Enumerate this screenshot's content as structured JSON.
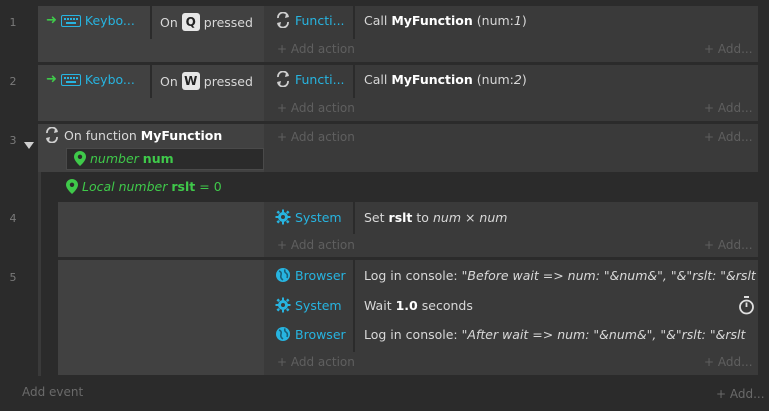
{
  "events": [
    {
      "number": "1",
      "condition": {
        "object": "Keybo...",
        "prefix": "On",
        "key": "Q",
        "suffix": "pressed"
      },
      "action": {
        "object": "Functi...",
        "text_prefix": "Call",
        "func": "MyFunction",
        "args": "(num: ",
        "argval": "1",
        "argclose": ")"
      }
    },
    {
      "number": "2",
      "condition": {
        "object": "Keybo...",
        "prefix": "On",
        "key": "W",
        "suffix": "pressed"
      },
      "action": {
        "object": "Functi...",
        "text_prefix": "Call",
        "func": "MyFunction",
        "args": "(num: ",
        "argval": "2",
        "argclose": ")"
      }
    }
  ],
  "function_block": {
    "number": "3",
    "label": "On function",
    "name": "MyFunction",
    "param_type": "number",
    "param_name": "num",
    "local_label": "Local number",
    "local_name": "rslt",
    "local_eq": "= 0"
  },
  "sub_event_4": {
    "number": "4",
    "object": "System",
    "text_prefix": "Set",
    "var": "rslt",
    "to": "to",
    "expr": "num × num"
  },
  "sub_event_5": {
    "number": "5",
    "actions": [
      {
        "object": "Browser",
        "text": "Log in console:",
        "value": "\"Before wait => num: \"&num&\", \"&\"rslt: \"&rslt"
      },
      {
        "object": "System",
        "text": "Wait",
        "bold": "1.0",
        "tail": "seconds"
      },
      {
        "object": "Browser",
        "text": "Log in console:",
        "value": "\"After wait => num: \"&num&\", \"&\"rslt: \"&rslt"
      }
    ]
  },
  "labels": {
    "add_action": "Add action",
    "add_short": "Add...",
    "add_event": "Add event"
  },
  "colors": {
    "accent": "#27b4e0",
    "green": "#3fc94a"
  }
}
